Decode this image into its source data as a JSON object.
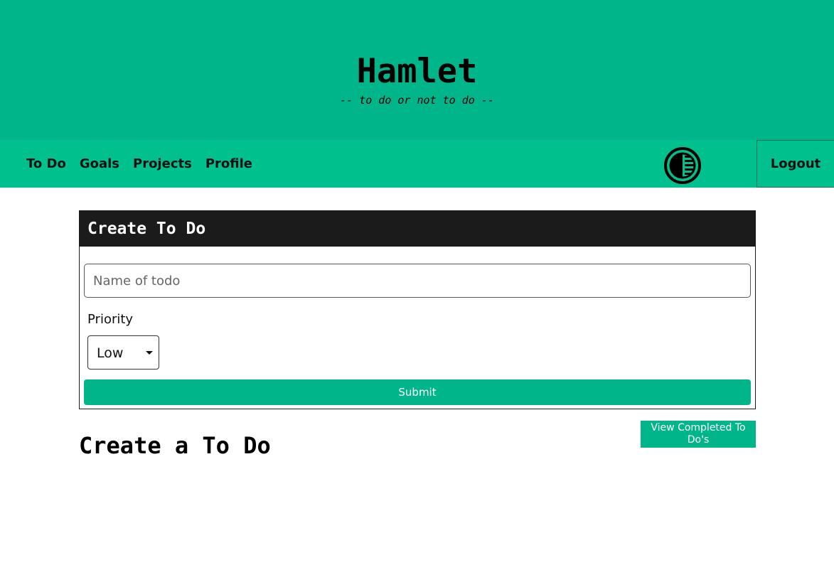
{
  "header": {
    "title": "Hamlet",
    "tagline": "-- to do or not to do --"
  },
  "nav": {
    "items": [
      {
        "label": "To Do"
      },
      {
        "label": "Goals"
      },
      {
        "label": "Projects"
      },
      {
        "label": "Profile"
      }
    ],
    "theme_toggle_icon": "contrast-icon",
    "logout_label": "Logout"
  },
  "create_form": {
    "heading": "Create To Do",
    "name_placeholder": "Name of todo",
    "name_value": "",
    "priority_label": "Priority",
    "priority_selected": "Low",
    "priority_caret_icon": "caret-down-icon",
    "submit_label": "Submit"
  },
  "main": {
    "section_title": "Create a To Do",
    "view_completed_label": "View Completed To Do's"
  },
  "colors": {
    "brand": "#00b589",
    "nav": "#00c08e",
    "card_header": "#1b1b1b"
  }
}
